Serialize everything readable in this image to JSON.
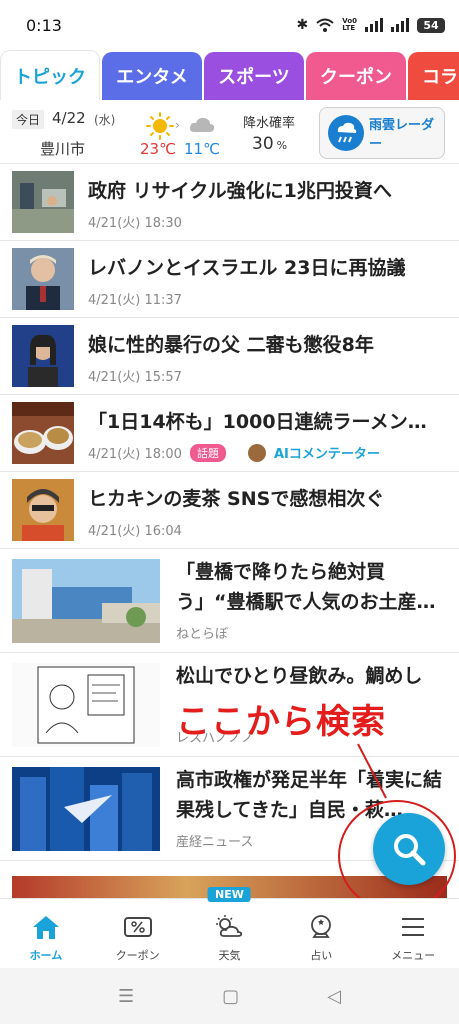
{
  "status_bar": {
    "time": "0:13",
    "battery": "54",
    "network_top": "Vo0",
    "network_bottom": "LTE"
  },
  "tabs": [
    "トピック",
    "エンタメ",
    "スポーツ",
    "クーポン",
    "コラ"
  ],
  "weather": {
    "today_label": "今日",
    "date": "4/22",
    "day_of_week": "(水)",
    "city": "豊川市",
    "temp_high": "23℃",
    "temp_low": "11℃",
    "rain_label": "降水確率",
    "rain_value": "30",
    "rain_unit": "%",
    "radar_label": "雨雲レーダー"
  },
  "news": [
    {
      "title": "政府 リサイクル強化に1兆円投資へ",
      "time": "4/21(火) 18:30"
    },
    {
      "title": "レバノンとイスラエル 23日に再協議",
      "time": "4/21(火) 11:37"
    },
    {
      "title": "娘に性的暴行の父 二審も懲役8年",
      "time": "4/21(火) 15:57"
    },
    {
      "title": "「1日14杯も」1000日連続ラーメン…",
      "time": "4/21(火) 18:00",
      "tag": "話題",
      "commentator": "AIコメンテーター"
    },
    {
      "title": "ヒカキンの麦茶 SNSで感想相次ぐ",
      "time": "4/21(火) 16:04"
    }
  ],
  "features": [
    {
      "title": "「豊橋で降りたら絶対買う」“豊橋駅で人気のお土産…",
      "source": "ねとらぼ"
    },
    {
      "title": "松山でひとり昼飲み。鯛めし",
      "source": "レスハノノノ"
    },
    {
      "title": "高市政権が発足半年「着実に結果残してきた」自民・萩…",
      "source": "産経ニュース"
    }
  ],
  "annotation": "ここから検索",
  "bottom_nav": {
    "items": [
      {
        "label": "ホーム",
        "icon": "home-icon"
      },
      {
        "label": "クーポン",
        "icon": "coupon-icon"
      },
      {
        "label": "天気",
        "icon": "weather-icon"
      },
      {
        "label": "占い",
        "icon": "fortune-icon"
      },
      {
        "label": "メニュー",
        "icon": "menu-icon"
      }
    ],
    "new_badge": "NEW"
  },
  "colors": {
    "accent": "#1aa3d9",
    "annotation_red": "#e41c1c"
  }
}
